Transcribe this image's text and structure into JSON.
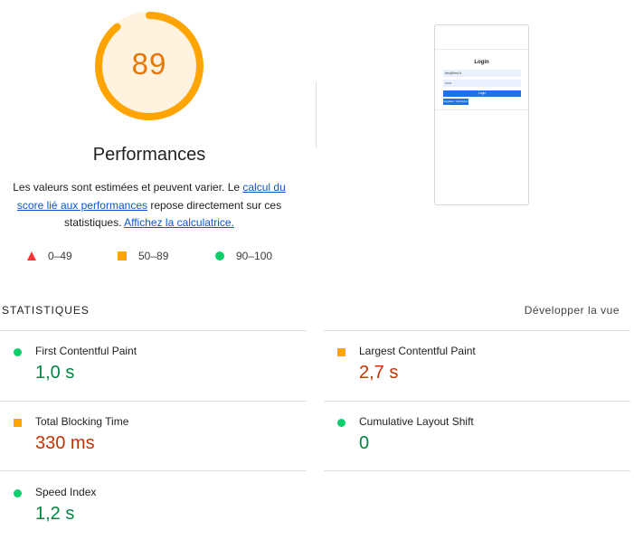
{
  "gauge": {
    "score": "89",
    "fraction": 0.89,
    "color": "#ffa400"
  },
  "performance": {
    "title": "Performances",
    "desc_part1": "Les valeurs sont estimées et peuvent varier. Le ",
    "desc_link1": "calcul du score lié aux performances",
    "desc_part2": " repose directement sur ces statistiques. ",
    "desc_link2": "Affichez la calculatrice."
  },
  "legend": [
    {
      "range": "0–49",
      "shape": "triangle",
      "color": "#ff3333"
    },
    {
      "range": "50–89",
      "shape": "square",
      "color": "#ffa400"
    },
    {
      "range": "90–100",
      "shape": "circle",
      "color": "#0cce6b"
    }
  ],
  "screenshot": {
    "title": "Login",
    "field1": "test@test.fr",
    "field2": "••••••",
    "button": "Login",
    "register": "Register / Inscription"
  },
  "stats": {
    "title": "STATISTIQUES",
    "expand_label": "Développer la vue",
    "metrics": [
      {
        "name": "First Contentful Paint",
        "value": "1,0 s",
        "rating": "good"
      },
      {
        "name": "Largest Contentful Paint",
        "value": "2,7 s",
        "rating": "average"
      },
      {
        "name": "Total Blocking Time",
        "value": "330 ms",
        "rating": "average"
      },
      {
        "name": "Cumulative Layout Shift",
        "value": "0",
        "rating": "good"
      },
      {
        "name": "Speed Index",
        "value": "1,2 s",
        "rating": "good"
      }
    ]
  }
}
